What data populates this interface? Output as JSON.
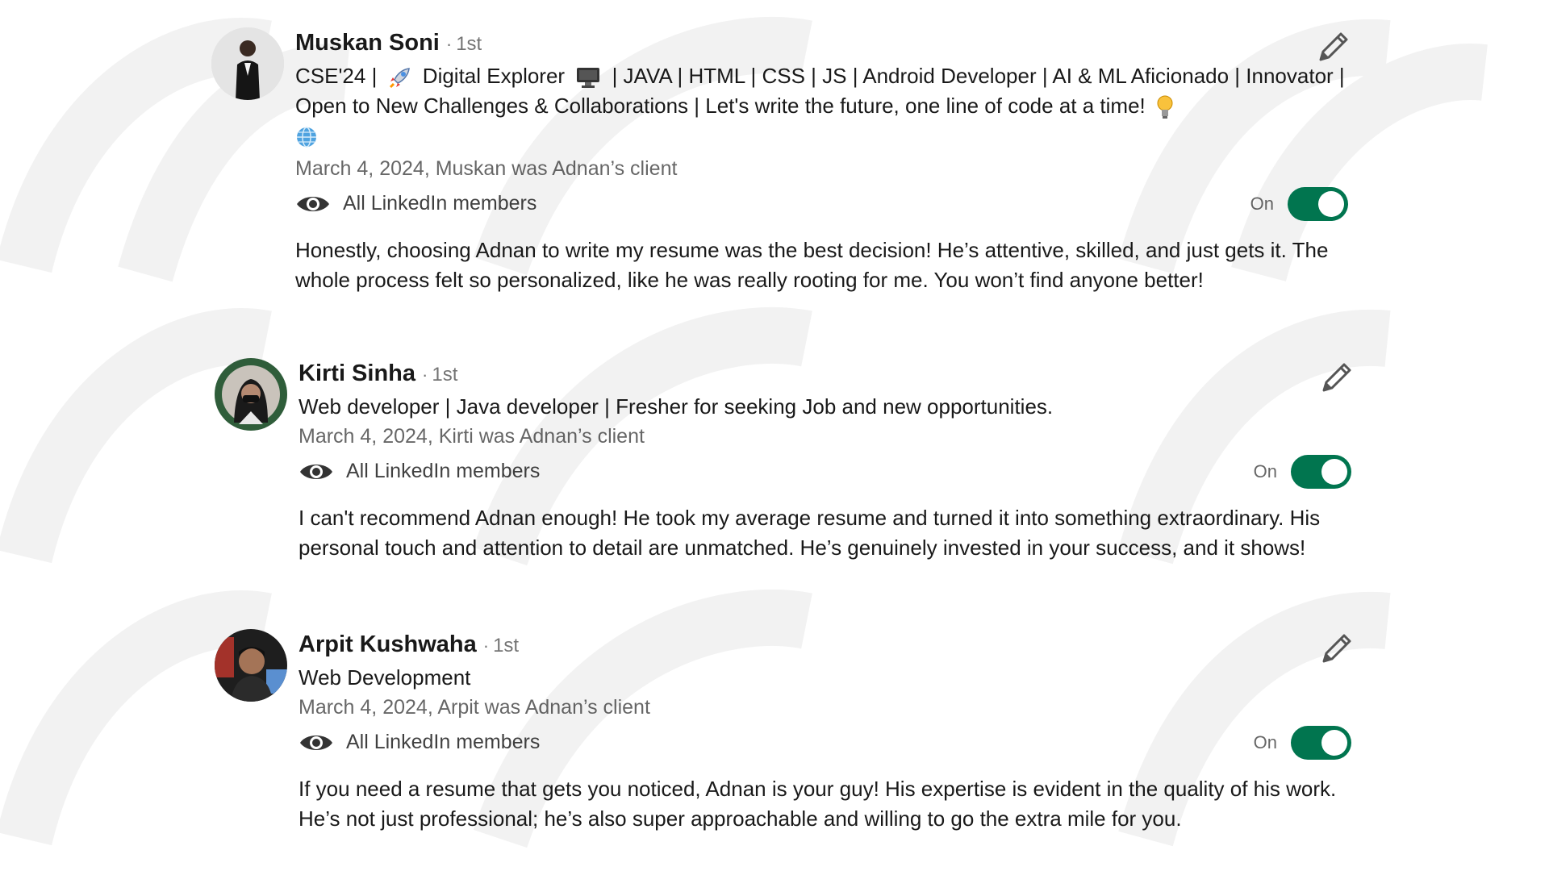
{
  "recommendations": [
    {
      "name": "Muskan Soni",
      "separator": "·",
      "degree": "1st",
      "headline_parts": [
        "CSE'24 |",
        "Digital Explorer",
        "| JAVA | HTML | CSS | JS | Android Developer | AI & ML Aficionado | Innovator | Open to New Challenges & Collaborations | Let's write the future, one line of code at a time!"
      ],
      "headline_icons": [
        "rocket-icon",
        "computer-icon",
        "lightbulb-icon",
        "globe-icon"
      ],
      "date": "March 4, 2024, Muskan was Adnan’s client",
      "visibility": "All LinkedIn members",
      "toggle_label": "On",
      "text": "Honestly, choosing Adnan to write my resume was the best decision! He’s attentive, skilled, and just gets it. The whole process felt so personalized, like he was really rooting for me. You won’t find anyone better!"
    },
    {
      "name": "Kirti Sinha",
      "separator": "·",
      "degree": "1st",
      "headline": "Web developer | Java developer | Fresher for seeking Job and new opportunities.",
      "date": "March 4, 2024, Kirti was Adnan’s client",
      "visibility": "All LinkedIn members",
      "toggle_label": "On",
      "text": "I can't recommend Adnan enough! He took my average resume and turned it into something extraordinary. His personal touch and attention to detail are unmatched. He’s genuinely invested in your success, and it shows!"
    },
    {
      "name": "Arpit Kushwaha",
      "separator": "·",
      "degree": "1st",
      "headline": "Web Development",
      "date": "March 4, 2024, Arpit was Adnan’s client",
      "visibility": "All LinkedIn members",
      "toggle_label": "On",
      "text": "If you need a resume that gets you noticed, Adnan is your guy! His expertise is evident in the quality of his work. He’s not just professional; he’s also super approachable and willing to go the extra mile for you."
    }
  ],
  "colors": {
    "toggle_on": "#01754f",
    "watermark": "#f3f3f3"
  },
  "icons": {
    "edit": "pencil-icon",
    "visibility": "eye-icon"
  }
}
